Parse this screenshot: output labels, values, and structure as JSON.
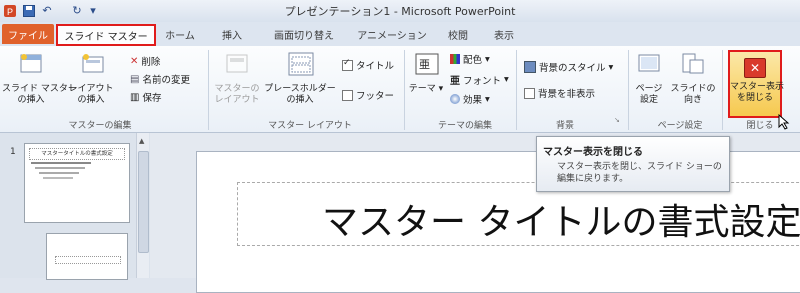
{
  "window": {
    "title": "プレゼンテーション1 - Microsoft PowerPoint",
    "qat_undo": "↶",
    "qat_redo": "↻"
  },
  "tabs": [
    {
      "label": "ファイル"
    },
    {
      "label": "スライド マスター"
    },
    {
      "label": "ホーム"
    },
    {
      "label": "挿入"
    },
    {
      "label": "画面切り替え"
    },
    {
      "label": "アニメーション"
    },
    {
      "label": "校閲"
    },
    {
      "label": "表示"
    }
  ],
  "ribbon": {
    "master_edit": {
      "insert_slide_master": "スライド マスター\nの挿入",
      "insert_layout": "レイアウト\nの挿入",
      "delete": "削除",
      "rename": "名前の変更",
      "preserve": "保存",
      "group_label": "マスターの編集"
    },
    "master_layout": {
      "master_layout": "マスターの\nレイアウト",
      "insert_placeholder": "プレースホルダー\nの挿入",
      "title_check": "タイトル",
      "footer_check": "フッター",
      "group_label": "マスター レイアウト"
    },
    "theme_edit": {
      "themes": "テーマ",
      "colors": "配色",
      "fonts": "フォント",
      "effects": "効果",
      "group_label": "テーマの編集"
    },
    "background": {
      "background_styles": "背景のスタイル",
      "hide_background": "背景を非表示",
      "group_label": "背景"
    },
    "page_setup": {
      "page_setup": "ページ\n設定",
      "slide_orientation": "スライドの\n向き",
      "group_label": "ページ設定"
    },
    "close": {
      "close_master_view": "マスター表示\nを閉じる",
      "group_label": "閉じる"
    }
  },
  "tooltip": {
    "title": "マスター表示を閉じる",
    "body": "マスター表示を閉じ、スライド ショーの\n編集に戻ります。"
  },
  "slide_pane": {
    "thumb1_number": "1",
    "thumb1_title": "マスタータイトルの書式設定"
  },
  "slide": {
    "title": "マスター タイトルの書式設定"
  },
  "colors": {
    "file_tab": "#e0612b",
    "highlight": "#e01b1b",
    "close_button": "#f6c94f"
  }
}
